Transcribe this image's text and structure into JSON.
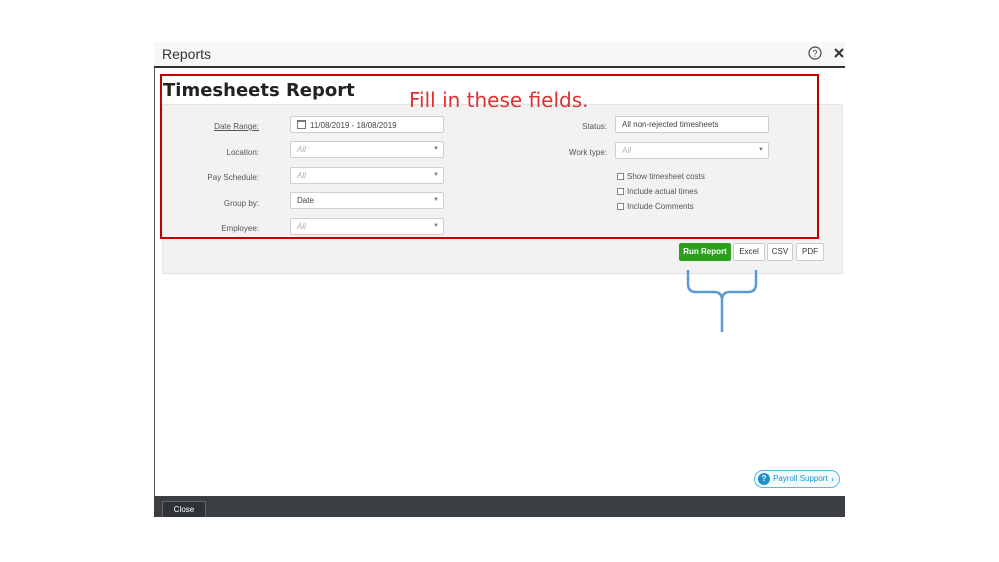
{
  "modal": {
    "title": "Reports",
    "help_icon": "help-circle-icon",
    "close_icon": "close-icon"
  },
  "report": {
    "title": "Timesheets Report"
  },
  "form": {
    "date_range": {
      "label": "Date Range:",
      "value": "11/08/2019 - 18/08/2019",
      "icon": "calendar-icon"
    },
    "location": {
      "label": "Location:",
      "placeholder": "All"
    },
    "pay_schedule": {
      "label": "Pay Schedule:",
      "placeholder": "All"
    },
    "group_by": {
      "label": "Group by:",
      "value": "Date"
    },
    "employee": {
      "label": "Employee:",
      "placeholder": "All"
    },
    "status": {
      "label": "Status:",
      "value": "All non-rejected timesheets"
    },
    "work_type": {
      "label": "Work type:",
      "placeholder": "All"
    },
    "checkboxes": [
      {
        "label": "Show timesheet costs",
        "checked": false
      },
      {
        "label": "Include actual times",
        "checked": false
      },
      {
        "label": "Include Comments",
        "checked": false
      }
    ]
  },
  "actions": {
    "run_report": "Run Report",
    "excel": "Excel",
    "csv": "CSV",
    "pdf": "PDF"
  },
  "payroll_support": {
    "label": "Payroll Support",
    "icon_glyph": "?"
  },
  "footer": {
    "close_label": "Close"
  },
  "annotation": {
    "text": "Fill in these fields."
  },
  "colors": {
    "run_button": "#2ca01c",
    "annotation_red": "#c00000",
    "brace_blue": "#5b9bd5",
    "support_blue": "#1d8fcc"
  }
}
